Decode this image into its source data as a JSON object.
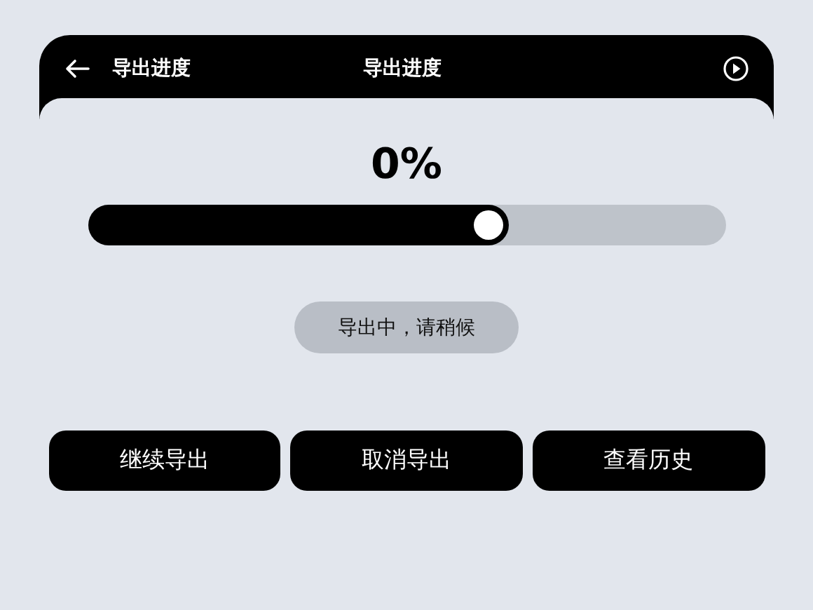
{
  "header": {
    "back_title": "导出进度",
    "title": "导出进度"
  },
  "progress": {
    "percent": "0%",
    "level": 0.66
  },
  "status": "导出中，请稍候",
  "buttons": [
    {
      "label": "继续导出"
    },
    {
      "label": "取消导出"
    },
    {
      "label": "查看历史"
    }
  ]
}
